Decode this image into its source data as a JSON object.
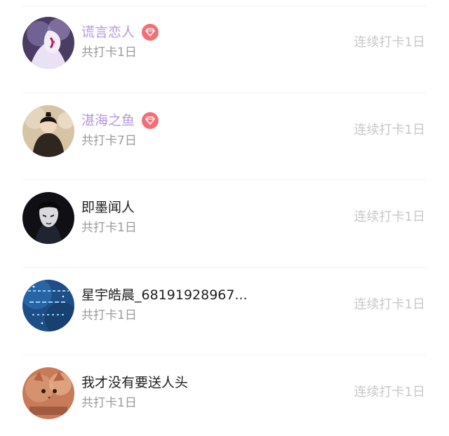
{
  "checkin_list": {
    "items": [
      {
        "name": "谎言恋人",
        "vip": true,
        "total": "共打卡1日",
        "streak": "连续打卡1日",
        "avatar_icon": "anime-character-avatar",
        "colors": {
          "bg": "#4a3c63",
          "accent": "#e9e2f4"
        }
      },
      {
        "name": "湛海之鱼",
        "vip": true,
        "total": "共打卡7日",
        "streak": "连续打卡1日",
        "avatar_icon": "ancient-costume-avatar",
        "colors": {
          "bg": "#d7c3a6",
          "accent": "#2f2620"
        }
      },
      {
        "name": "即墨闻人",
        "vip": false,
        "total": "共打卡1日",
        "streak": "连续打卡1日",
        "avatar_icon": "dark-character-avatar",
        "colors": {
          "bg": "#101014",
          "accent": "#d9d9de"
        }
      },
      {
        "name": "星宇皓晨_68191928967...",
        "vip": false,
        "total": "共打卡1日",
        "streak": "连续打卡1日",
        "avatar_icon": "starry-text-avatar",
        "colors": {
          "bg": "#1f4e86",
          "accent": "#8fd0ff"
        }
      },
      {
        "name": "我才没有要送人头",
        "vip": false,
        "total": "共打卡1日",
        "streak": "连续打卡1日",
        "avatar_icon": "cat-text-avatar",
        "colors": {
          "bg": "#c77b59",
          "accent": "#6b2e1f"
        }
      }
    ]
  },
  "colors": {
    "vip_name": "#b597de",
    "vip_badge": "#f46e75",
    "divider": "#f2f2f2",
    "muted_text": "#9a9a9a",
    "streak_text": "#c8c8c8"
  }
}
